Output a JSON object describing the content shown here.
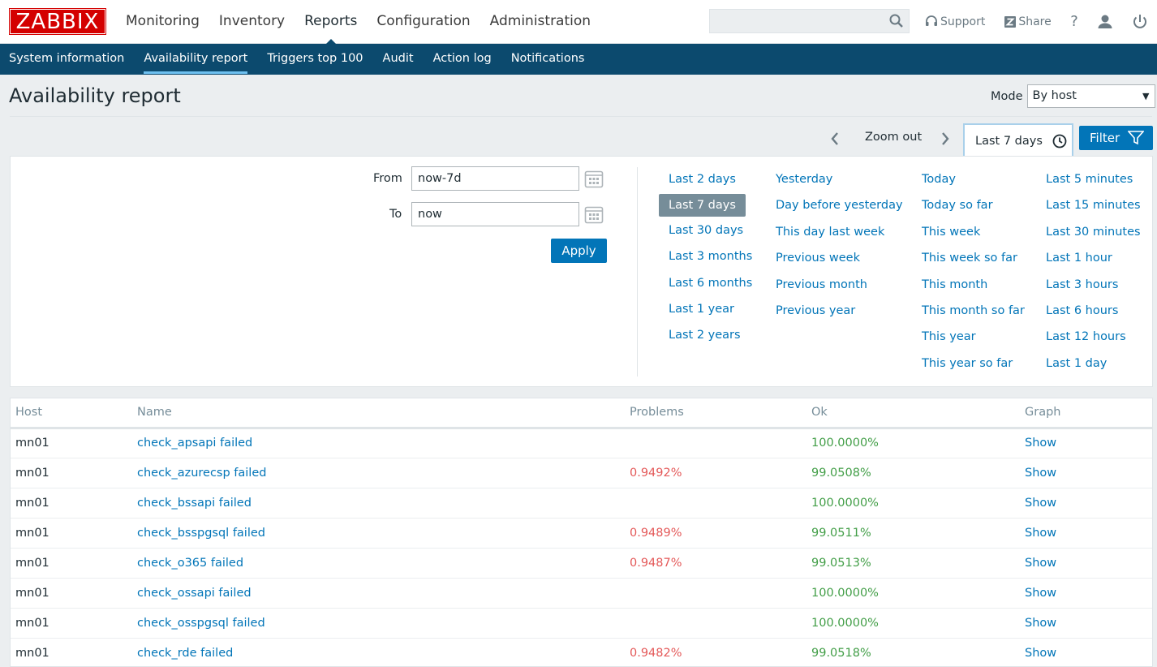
{
  "header": {
    "logo": "ZABBIX",
    "menu": [
      "Monitoring",
      "Inventory",
      "Reports",
      "Configuration",
      "Administration"
    ],
    "active_menu": "Reports",
    "search": {
      "value": "",
      "placeholder": ""
    },
    "support_label": "Support",
    "share_label": "Share",
    "help_label": "?"
  },
  "subnav": {
    "items": [
      "System information",
      "Availability report",
      "Triggers top 100",
      "Audit",
      "Action log",
      "Notifications"
    ],
    "active": "Availability report"
  },
  "page": {
    "title": "Availability report",
    "mode_label": "Mode",
    "mode_value": "By host"
  },
  "timeline": {
    "zoom_out": "Zoom out",
    "current_range": "Last 7 days",
    "filter_label": "Filter"
  },
  "filter": {
    "from_label": "From",
    "from_value": "now-7d",
    "to_label": "To",
    "to_value": "now",
    "apply_label": "Apply",
    "quick_ranges": [
      [
        "Last 2 days",
        "Last 7 days",
        "Last 30 days",
        "Last 3 months",
        "Last 6 months",
        "Last 1 year",
        "Last 2 years"
      ],
      [
        "Yesterday",
        "Day before yesterday",
        "This day last week",
        "Previous week",
        "Previous month",
        "Previous year"
      ],
      [
        "Today",
        "Today so far",
        "This week",
        "This week so far",
        "This month",
        "This month so far",
        "This year",
        "This year so far"
      ],
      [
        "Last 5 minutes",
        "Last 15 minutes",
        "Last 30 minutes",
        "Last 1 hour",
        "Last 3 hours",
        "Last 6 hours",
        "Last 12 hours",
        "Last 1 day"
      ]
    ],
    "selected_range": "Last 7 days"
  },
  "table": {
    "columns": [
      "Host",
      "Name",
      "Problems",
      "Ok",
      "Graph"
    ],
    "rows": [
      {
        "host": "mn01",
        "name": "check_apsapi failed",
        "problems": "",
        "ok": "100.0000%",
        "graph": "Show"
      },
      {
        "host": "mn01",
        "name": "check_azurecsp failed",
        "problems": "0.9492%",
        "ok": "99.0508%",
        "graph": "Show"
      },
      {
        "host": "mn01",
        "name": "check_bssapi failed",
        "problems": "",
        "ok": "100.0000%",
        "graph": "Show"
      },
      {
        "host": "mn01",
        "name": "check_bsspgsql failed",
        "problems": "0.9489%",
        "ok": "99.0511%",
        "graph": "Show"
      },
      {
        "host": "mn01",
        "name": "check_o365 failed",
        "problems": "0.9487%",
        "ok": "99.0513%",
        "graph": "Show"
      },
      {
        "host": "mn01",
        "name": "check_ossapi failed",
        "problems": "",
        "ok": "100.0000%",
        "graph": "Show"
      },
      {
        "host": "mn01",
        "name": "check_osspgsql failed",
        "problems": "",
        "ok": "100.0000%",
        "graph": "Show"
      },
      {
        "host": "mn01",
        "name": "check_rde failed",
        "problems": "0.9482%",
        "ok": "99.0518%",
        "graph": "Show"
      }
    ]
  },
  "colors": {
    "brand": "#d40000",
    "subnav_bg": "#0c4a6e",
    "link": "#0275b8",
    "problem": "#e45959",
    "ok": "#429e47"
  }
}
